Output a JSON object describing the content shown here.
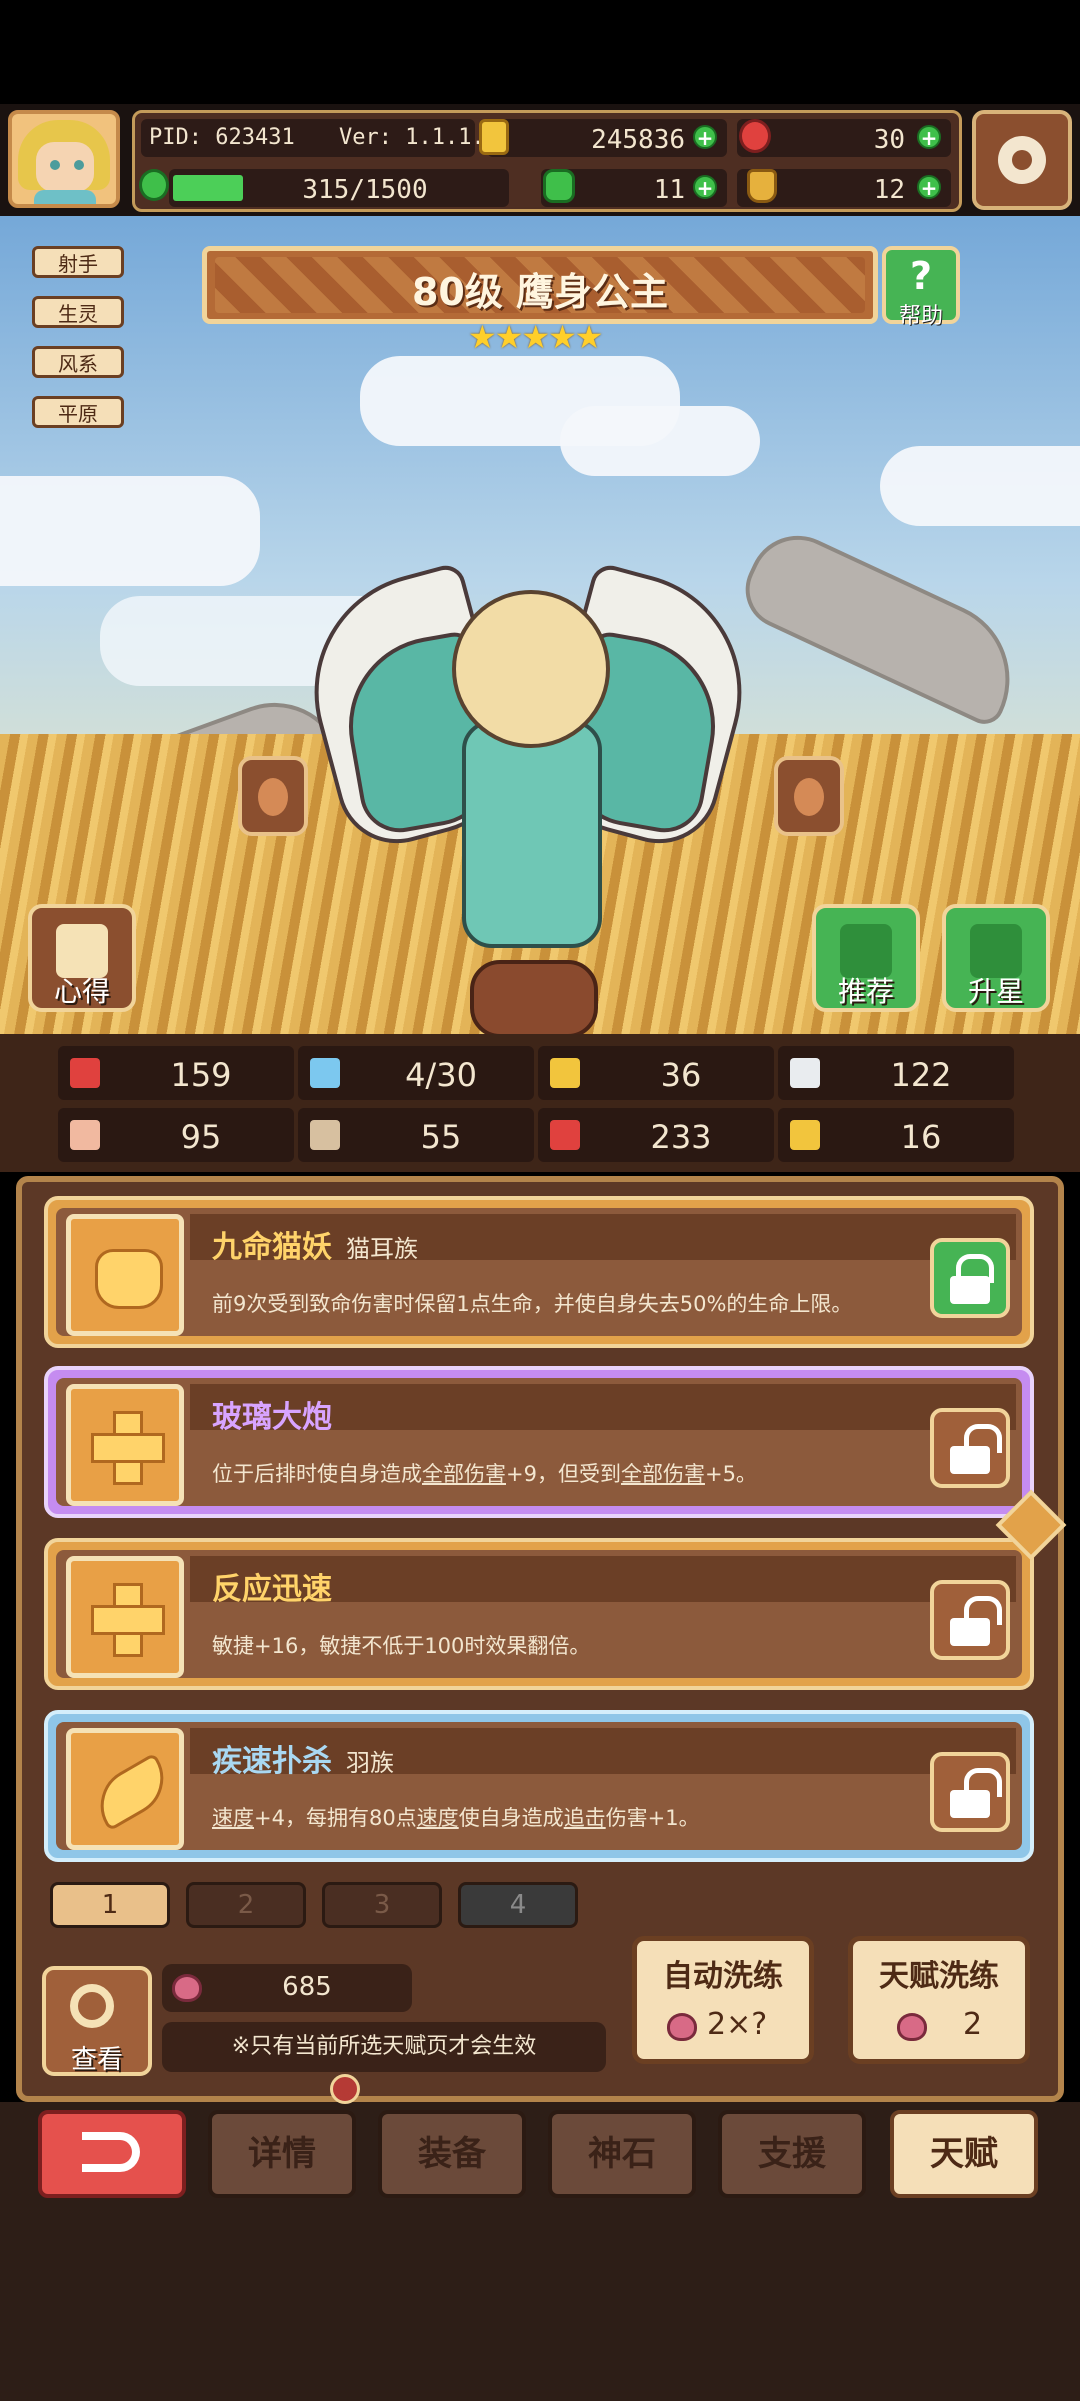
{
  "hud": {
    "pid": "PID: 623431",
    "version": "Ver: 1.1.1.8",
    "gold": "245836",
    "hearts": "30",
    "energy": "315/1500",
    "clover": "11",
    "bag": "12",
    "energy_progress": 0.21
  },
  "tags": [
    "射手",
    "生灵",
    "风系",
    "平原"
  ],
  "hero": {
    "title": "80级  鹰身公主",
    "stars": "★★★★★",
    "help_label": "帮助",
    "notes_label": "心得",
    "recommend_label": "推荐",
    "star_up_label": "升星"
  },
  "stats": [
    {
      "icon": "heart-icon",
      "value": "159"
    },
    {
      "icon": "water-drop-icon",
      "value": "4/30"
    },
    {
      "icon": "shield-icon",
      "value": "36"
    },
    {
      "icon": "wing-icon",
      "value": "122"
    },
    {
      "icon": "fist-icon",
      "value": "95"
    },
    {
      "icon": "book-icon",
      "value": "55"
    },
    {
      "icon": "potion-icon",
      "value": "233"
    },
    {
      "icon": "magnet-icon",
      "value": "16"
    }
  ],
  "talents": [
    {
      "name": "九命猫妖",
      "tag": "猫耳族",
      "desc": "前9次受到致命伤害时保留1点生命，并使自身失去50%的生命上限。",
      "locked": true
    },
    {
      "name": "玻璃大炮",
      "tag": "",
      "desc_parts": [
        "位于后排时使自身造成",
        "全部伤害",
        "+9，但受到",
        "全部伤害",
        "+5。"
      ],
      "locked": false
    },
    {
      "name": "反应迅速",
      "tag": "",
      "desc": "敏捷+16，敏捷不低于100时效果翻倍。",
      "locked": false
    },
    {
      "name": "疾速扑杀",
      "tag": "羽族",
      "desc_parts": [
        "速度",
        "+4，每拥有80点",
        "速度",
        "使自身造成",
        "追击",
        "伤害+1。"
      ],
      "locked": false
    }
  ],
  "pages": [
    "1",
    "2",
    "3",
    "4"
  ],
  "bottom": {
    "view_label": "查看",
    "peach_count": "685",
    "note": "※只有当前所选天赋页才会生效",
    "auto_refine_label": "自动洗练",
    "auto_refine_cost": "2×?",
    "talent_refine_label": "天赋洗练",
    "talent_refine_cost": "2"
  },
  "nav": {
    "details": "详情",
    "equip": "装备",
    "godstone": "神石",
    "support": "支援",
    "talent": "天赋"
  },
  "colors": {
    "gold_text": "#ffd36a",
    "purple_text": "#c58cf0",
    "blue_text": "#a9d8f2",
    "green_button": "#46b454"
  }
}
